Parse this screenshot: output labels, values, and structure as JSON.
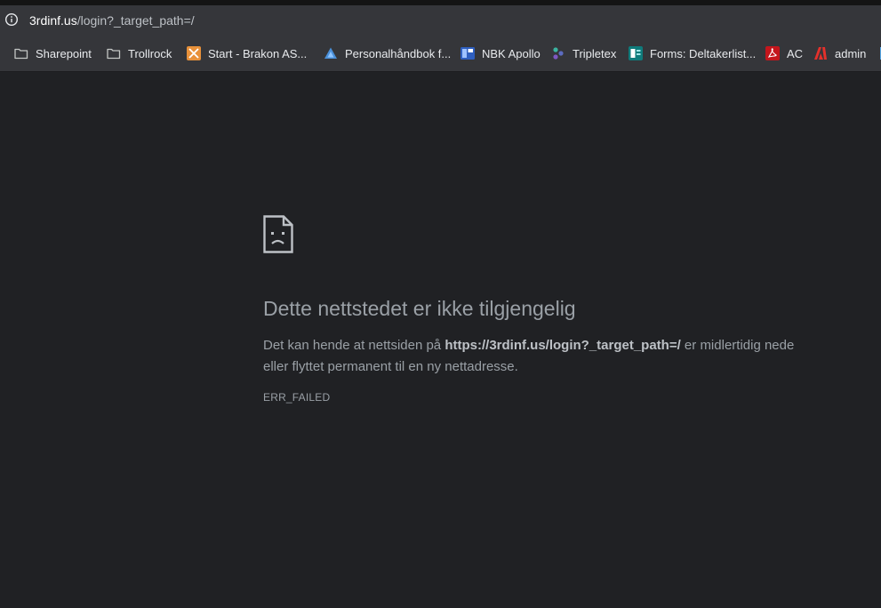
{
  "address_bar": {
    "host": "3rdinf.us",
    "path": "/login?_target_path=/"
  },
  "bookmarks": [
    {
      "label": "Sharepoint",
      "icon": "folder-icon"
    },
    {
      "label": "Trollrock",
      "icon": "folder-icon"
    },
    {
      "label": "Start - Brakon AS...",
      "icon": "brakon-x-icon"
    },
    {
      "label": "Personalhåndbok f...",
      "icon": "blue-triangle-icon"
    },
    {
      "label": "NBK Apollo",
      "icon": "nbk-apollo-icon"
    },
    {
      "label": "Tripletex",
      "icon": "tripletex-icon"
    },
    {
      "label": "Forms: Deltakerlist...",
      "icon": "forms-icon"
    },
    {
      "label": "AC",
      "icon": "acrobat-icon"
    },
    {
      "label": "admin",
      "icon": "adobe-icon"
    }
  ],
  "error_page": {
    "title": "Dette nettstedet er ikke tilgjengelig",
    "desc_prefix": "Det kan hende at nettsiden på ",
    "desc_url": "https://3rdinf.us/login?_target_path=/",
    "desc_suffix": " er midlertidig nede eller flyttet permanent til en ny nettadresse.",
    "code": "ERR_FAILED"
  },
  "colors": {
    "background": "#202124",
    "toolbar": "#35363a",
    "text_muted": "#9aa0a6",
    "text_light": "#e8eaed"
  }
}
